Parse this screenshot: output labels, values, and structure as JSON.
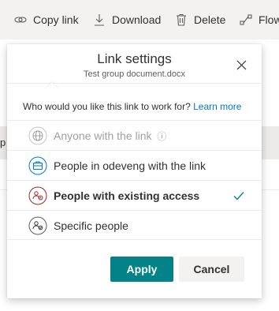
{
  "toolbar": {
    "copy_link": "Copy link",
    "download": "Download",
    "delete": "Delete",
    "flow": "Flow"
  },
  "background": {
    "row_text": "p"
  },
  "dialog": {
    "title": "Link settings",
    "subtitle": "Test group document.docx",
    "question": "Who would you like this link to work for?",
    "learn_more": "Learn more",
    "options": [
      {
        "label": "Anyone with the link",
        "icon": "globe-icon",
        "state": "disabled",
        "info_glyph": "ⓘ"
      },
      {
        "label": "People in odeveng with the link",
        "icon": "briefcase-icon",
        "state": "normal"
      },
      {
        "label": "People with existing access",
        "icon": "people-existing-icon",
        "state": "selected",
        "check_glyph": "✓"
      },
      {
        "label": "Specific people",
        "icon": "specific-people-icon",
        "state": "normal"
      }
    ],
    "apply": "Apply",
    "cancel": "Cancel"
  },
  "colors": {
    "accent": "#038387",
    "link": "#0078d4",
    "icon_blue": "#0078d4",
    "icon_red": "#a4262c",
    "icon_gray": "#605e5c",
    "disabled": "#a19f9d"
  }
}
